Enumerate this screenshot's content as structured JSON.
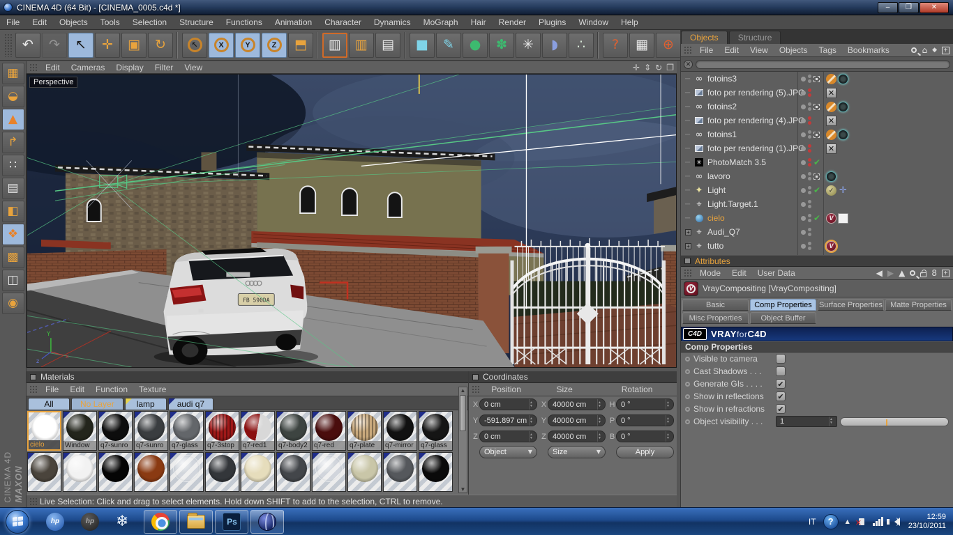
{
  "titlebar": {
    "title": "CINEMA 4D (64 Bit) - [CINEMA_0005.c4d *]",
    "minimize": "–",
    "restore": "❐",
    "close": "✕"
  },
  "menubar": {
    "items": [
      "File",
      "Edit",
      "Objects",
      "Tools",
      "Selection",
      "Structure",
      "Functions",
      "Animation",
      "Character",
      "Dynamics",
      "MoGraph",
      "Hair",
      "Render",
      "Plugins",
      "Window",
      "Help"
    ]
  },
  "toolbar": {
    "items": [
      {
        "name": "undo",
        "glyph": "↶",
        "color": "#e8e8e8"
      },
      {
        "name": "redo",
        "glyph": "↷",
        "color": "#e8e8e8",
        "dim": true
      },
      {
        "name": "live-selection",
        "glyph": "↖",
        "color": "#1a1a1a",
        "active": true
      },
      {
        "name": "move",
        "glyph": "✛",
        "color": "#e8a33d"
      },
      {
        "name": "scale",
        "glyph": "▣",
        "color": "#e8a33d"
      },
      {
        "name": "rotate",
        "glyph": "↻",
        "color": "#e8a33d"
      },
      {
        "type": "sep"
      },
      {
        "name": "last-tool",
        "glyph": "↖",
        "color": "#e8a33d",
        "ring": true
      },
      {
        "name": "lock-x",
        "glyph": "X",
        "ring": true,
        "active": true
      },
      {
        "name": "lock-y",
        "glyph": "Y",
        "ring": true,
        "active": true
      },
      {
        "name": "lock-z",
        "glyph": "Z",
        "ring": true,
        "active": true
      },
      {
        "name": "coordinate-system",
        "glyph": "⬒",
        "color": "#e8a33d"
      },
      {
        "type": "sep"
      },
      {
        "name": "render-view",
        "glyph": "▥",
        "color": "#e8e8e8",
        "frame": true
      },
      {
        "name": "render-region",
        "glyph": "▥",
        "color": "#e8a33d"
      },
      {
        "name": "render-settings",
        "glyph": "▤",
        "color": "#e8e8e8"
      },
      {
        "type": "sep"
      },
      {
        "name": "primitive-cube",
        "glyph": "■",
        "color": "#7fd4e8"
      },
      {
        "name": "spline",
        "glyph": "✎",
        "color": "#7fd4e8"
      },
      {
        "name": "nurbs",
        "glyph": "●",
        "color": "#3dba6f"
      },
      {
        "name": "array",
        "glyph": "✽",
        "color": "#3dba6f"
      },
      {
        "name": "deformer",
        "glyph": "✳",
        "color": "#e8e8e8"
      },
      {
        "name": "environment",
        "glyph": "◗",
        "color": "#8a9fe0"
      },
      {
        "name": "particles",
        "glyph": "∴",
        "color": "#d8e8d8"
      },
      {
        "type": "sep"
      },
      {
        "name": "help",
        "glyph": "?",
        "color": "#e06030"
      },
      {
        "name": "command-manager",
        "glyph": "▦",
        "color": "#e8e8e8"
      },
      {
        "name": "content-browser",
        "glyph": "⊕",
        "color": "#e06030"
      }
    ]
  },
  "left_toolbar": {
    "items": [
      {
        "name": "layout",
        "glyph": "▦",
        "color": "#e8a33d"
      },
      {
        "name": "make-editable",
        "glyph": "◒",
        "color": "#e8a33d"
      },
      {
        "name": "model-mode",
        "glyph": "▲",
        "color": "#e8822a",
        "active": true
      },
      {
        "name": "axis-mode",
        "glyph": "↱",
        "color": "#e8a33d"
      },
      {
        "name": "points-mode",
        "glyph": "∷",
        "color": "#e8e8e8"
      },
      {
        "name": "edge-mode",
        "glyph": "▤",
        "color": "#e8e8e8"
      },
      {
        "name": "polygon-mode",
        "glyph": "◧",
        "color": "#e8a33d"
      },
      {
        "name": "object-mode",
        "glyph": "❖",
        "color": "#e8822a",
        "active": true
      },
      {
        "name": "texture-mode",
        "glyph": "▩",
        "color": "#e8a33d"
      },
      {
        "name": "texture-axis-mode",
        "glyph": "◫",
        "color": "#e8e8e8"
      },
      {
        "name": "snap",
        "glyph": "◉",
        "color": "#e8a33d"
      }
    ],
    "branding_top": "MAXON",
    "branding_bottom": "CINEMA 4D"
  },
  "viewport": {
    "menu": [
      "Edit",
      "Cameras",
      "Display",
      "Filter",
      "View"
    ],
    "label": "Perspective",
    "nav": [
      {
        "name": "pan",
        "glyph": "✛"
      },
      {
        "name": "dolly",
        "glyph": "⇕"
      },
      {
        "name": "orbit",
        "glyph": "↻"
      },
      {
        "name": "toggle-view",
        "glyph": "❐"
      }
    ],
    "scene": {
      "plate": "FB 590DA",
      "axis_y": "Y",
      "axis_x": "x",
      "axis_z": "z"
    }
  },
  "materials": {
    "title": "Materials",
    "menu": [
      "File",
      "Edit",
      "Function",
      "Texture"
    ],
    "tabs": [
      {
        "label": "All",
        "active": true
      },
      {
        "label": "No Layer",
        "orange": true
      },
      {
        "label": "lamp",
        "corner": "#e8d44d"
      },
      {
        "label": "audi q7",
        "corner": "#1f2d8a"
      }
    ],
    "row1": [
      {
        "label": "cielo",
        "color": "#ffffff",
        "selected": true
      },
      {
        "label": "Window",
        "color": "#23251c",
        "corner": true
      },
      {
        "label": "q7-sunro",
        "color": "#0d0d0d",
        "corner": true
      },
      {
        "label": "q7-sunro",
        "color": "#3a3d40",
        "corner": true
      },
      {
        "label": "q7-glass",
        "color": "#63666a",
        "corner": true
      },
      {
        "label": "q7-3stop",
        "color": "#a01818",
        "corner": true,
        "ribbed": true
      },
      {
        "label": "q7-red1",
        "color": "#8a1010",
        "split": "#d8d8d8",
        "corner": true
      },
      {
        "label": "q7-body2",
        "color": "#3d4441",
        "corner": true
      },
      {
        "label": "q7-red",
        "color": "#4a0d0d",
        "corner": true
      },
      {
        "label": "q7-plate",
        "color": "#c9a97c",
        "corner": true,
        "ribbed": true
      },
      {
        "label": "q7-mirror",
        "color": "#111111",
        "corner": true
      },
      {
        "label": "q7-glass",
        "color": "#151515",
        "corner": true
      }
    ],
    "row2": [
      {
        "label": "",
        "color": "#4a443c",
        "corner": true
      },
      {
        "label": "",
        "color": "#f2f2f2",
        "corner": true
      },
      {
        "label": "",
        "color": "#050505",
        "corner": true
      },
      {
        "label": "",
        "color": "#8a3a12",
        "corner": true
      },
      {
        "label": "",
        "color": "transparent",
        "corner": true
      },
      {
        "label": "",
        "color": "#33363a",
        "corner": true
      },
      {
        "label": "",
        "color": "#e6ddbc",
        "corner": true
      },
      {
        "label": "",
        "color": "#43464a",
        "corner": true
      },
      {
        "label": "",
        "color": "transparent",
        "corner": true
      },
      {
        "label": "",
        "color": "#c9c6a8",
        "corner": true
      },
      {
        "label": "",
        "color": "#55585c",
        "corner": true
      },
      {
        "label": "",
        "color": "#0a0a0a",
        "corner": true
      }
    ]
  },
  "coordinates": {
    "title": "Coordinates",
    "cols": [
      {
        "header": "Position",
        "rows": [
          {
            "axis": "X",
            "value": "0 cm"
          },
          {
            "axis": "Y",
            "value": "-591.897 cm"
          },
          {
            "axis": "Z",
            "value": "0 cm"
          }
        ],
        "footer": {
          "type": "dropdown",
          "label": "Object"
        }
      },
      {
        "header": "Size",
        "rows": [
          {
            "axis": "X",
            "value": "40000 cm"
          },
          {
            "axis": "Y",
            "value": "40000 cm"
          },
          {
            "axis": "Z",
            "value": "40000 cm"
          }
        ],
        "footer": {
          "type": "dropdown",
          "label": "Size"
        }
      },
      {
        "header": "Rotation",
        "rows": [
          {
            "axis": "H",
            "value": "0 °"
          },
          {
            "axis": "P",
            "value": "0 °"
          },
          {
            "axis": "B",
            "value": "0 °"
          }
        ],
        "footer": {
          "type": "button",
          "label": "Apply"
        }
      }
    ]
  },
  "status": {
    "text": "Live Selection: Click and drag to select elements. Hold down SHIFT to add to the selection, CTRL to remove."
  },
  "objects_panel": {
    "tabs": [
      {
        "label": "Objects",
        "active": true
      },
      {
        "label": "Structure"
      }
    ],
    "menu": [
      "File",
      "Edit",
      "View",
      "Objects",
      "Tags",
      "Bookmarks"
    ],
    "items": [
      {
        "label": "fotoins3",
        "icon": "camera",
        "dots": "gray",
        "extra": "target",
        "tags": [
          "no",
          "calib"
        ]
      },
      {
        "label": "foto per rendering (5).JPG",
        "icon": "image",
        "dots": "red",
        "tags": [
          "x"
        ]
      },
      {
        "label": "fotoins2",
        "icon": "camera",
        "dots": "gray",
        "extra": "target",
        "tags": [
          "no",
          "calib"
        ]
      },
      {
        "label": "foto per rendering (4).JPG",
        "icon": "image",
        "dots": "red",
        "tags": [
          "x"
        ]
      },
      {
        "label": "fotoins1",
        "icon": "camera",
        "dots": "gray",
        "extra": "target",
        "tags": [
          "no",
          "calib"
        ]
      },
      {
        "label": "foto per rendering (1).JPG",
        "icon": "image",
        "dots": "red",
        "tags": [
          "x"
        ]
      },
      {
        "label": "PhotoMatch 3.5",
        "icon": "photomatch",
        "dots": "red",
        "extra": "check",
        "tags": []
      },
      {
        "label": "lavoro",
        "icon": "camera",
        "dots": "gray",
        "extra": "target",
        "tags": [
          "calib"
        ]
      },
      {
        "label": "Light",
        "icon": "light",
        "dots": "gray",
        "extra": "check",
        "tags": [
          "vlight",
          "cross"
        ]
      },
      {
        "label": "Light.Target.1",
        "icon": "null",
        "dots": "gray",
        "tags": []
      },
      {
        "label": "cielo",
        "icon": "sky",
        "dots": "gray",
        "extra": "check",
        "selected": true,
        "tags": [
          "vred",
          "white"
        ]
      },
      {
        "label": "Audi_Q7",
        "icon": "null",
        "expand": true,
        "dots": "gray",
        "tags": []
      },
      {
        "label": "tutto",
        "icon": "null",
        "expand": true,
        "dots": "gray",
        "tags": [
          "vred-sel"
        ]
      }
    ]
  },
  "attributes": {
    "title": "Attributes",
    "menu": [
      "Mode",
      "Edit",
      "User Data"
    ],
    "object_title": "VrayCompositing [VrayCompositing]",
    "vray_logo_letter": "V",
    "tabs_row1": [
      {
        "label": "Basic"
      },
      {
        "label": "Comp Properties",
        "active": true
      },
      {
        "label": "Surface Properties"
      },
      {
        "label": "Matte Properties"
      }
    ],
    "tabs_row2": [
      {
        "label": "Misc Properties"
      },
      {
        "label": "Object Buffer"
      }
    ],
    "banner": {
      "logo": "C4D",
      "v": "VRAY",
      "f": "for",
      "c": "C4D"
    },
    "section": "Comp Properties",
    "props": [
      {
        "label": "Visible to camera",
        "checked": false
      },
      {
        "label": "Cast Shadows . . .",
        "checked": false
      },
      {
        "label": "Generate GIs . . . .",
        "checked": true
      },
      {
        "label": "Show in reflections",
        "checked": true
      },
      {
        "label": "Show in refractions",
        "checked": true
      }
    ],
    "visibility": {
      "label": "Object visibility . . .",
      "value": "1"
    },
    "check_glyph": "✔"
  },
  "taskbar": {
    "lang": "IT",
    "time": "12:59",
    "date": "23/10/2011",
    "help_glyph": "?",
    "hp": "hp",
    "ps": "Ps",
    "snow": "❄"
  }
}
